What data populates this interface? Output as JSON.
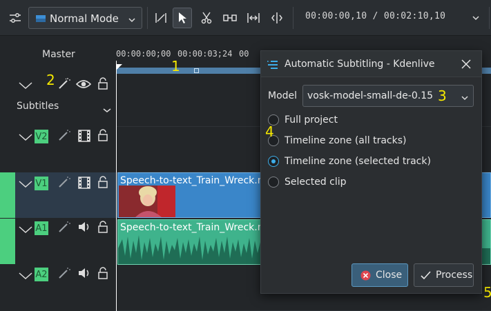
{
  "toolbar": {
    "mode_label": "Normal Mode",
    "timecode_current": "00:00:00,10",
    "timecode_separator": "/",
    "timecode_total": "00:02:10,10"
  },
  "tracks": {
    "master_label": "Master",
    "subtitles_label": "Subtitles",
    "v2": "V2",
    "v1": "V1",
    "a1": "A1",
    "a2": "A2"
  },
  "ruler": {
    "tick_0": "00:00:00;00",
    "tick_1": "00:00:03;24",
    "tick_2": "00"
  },
  "clips": {
    "video_name": "Speech-to-text_Train_Wreck.mp",
    "audio_name": "Speech-to-text_Train_Wreck.mp"
  },
  "dialog": {
    "title": "Automatic Subtitling - Kdenlive",
    "model_label": "Model",
    "model_value": "vosk-model-small-de-0.15",
    "options": [
      "Full project",
      "Timeline zone (all tracks)",
      "Timeline zone (selected track)",
      "Selected clip"
    ],
    "selected_option": "Timeline zone (selected track)",
    "close_label": "Close",
    "process_label": "Process"
  },
  "annotations": [
    "1",
    "2",
    "3",
    "4",
    "5"
  ],
  "colors": {
    "accent": "#3daee9",
    "track_active": "#4ccf7f",
    "video_clip": "#3a86c9",
    "audio_clip": "#3fb38c",
    "annotation": "#f5e800"
  }
}
